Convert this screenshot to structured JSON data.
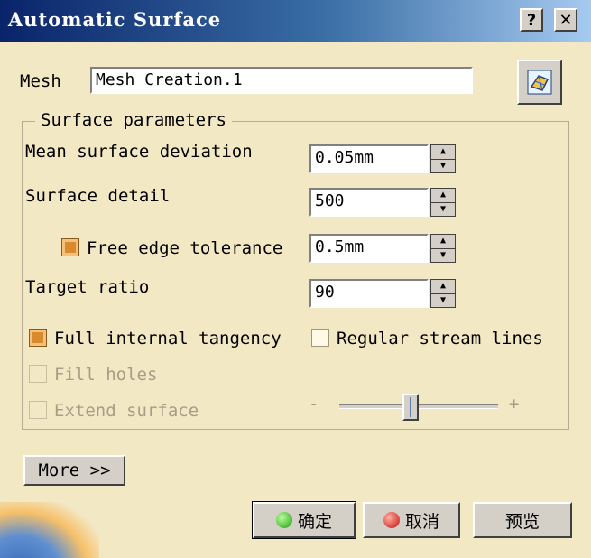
{
  "window": {
    "title": "Automatic Surface",
    "help_glyph": "?",
    "close_glyph": "✕"
  },
  "mesh": {
    "label": "Mesh",
    "value": "Mesh Creation.1",
    "select_icon": "mesh-select-icon"
  },
  "group": {
    "legend": "Surface parameters",
    "mean_deviation": {
      "label": "Mean surface deviation",
      "value": "0.05mm"
    },
    "surface_detail": {
      "label": "Surface detail",
      "value": "500"
    },
    "free_edge": {
      "label": "Free edge tolerance",
      "value": "0.5mm",
      "checked": true
    },
    "target_ratio": {
      "label": "Target ratio",
      "value": "90"
    },
    "full_tangency": {
      "label": "Full internal tangency",
      "checked": true
    },
    "stream_lines": {
      "label": "Regular stream lines",
      "checked": false
    },
    "fill_holes": {
      "label": "Fill holes",
      "checked": false,
      "enabled": false
    },
    "extend_surface": {
      "label": "Extend surface",
      "checked": false,
      "enabled": false
    },
    "slider": {
      "minus": "-",
      "plus": "+",
      "level": 0.45
    }
  },
  "more_button": "More >>",
  "buttons": {
    "ok": "确定",
    "cancel": "取消",
    "preview": "预览"
  },
  "colors": {
    "title_bar": "#0a246a",
    "dialog_bg": "#f3e8c4",
    "check_on": "#d98a2c"
  }
}
